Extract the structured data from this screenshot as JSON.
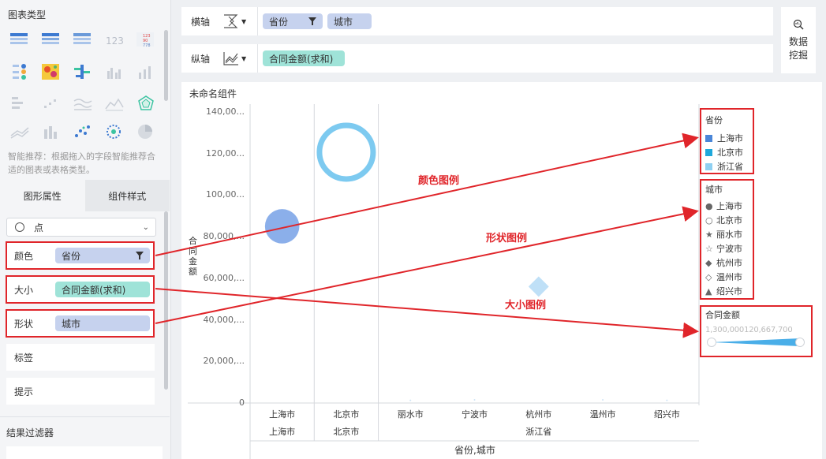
{
  "left": {
    "chart_type_title": "图表类型",
    "smart_tip": "智能推荐：根据拖入的字段智能推荐合适的图表或表格类型。",
    "tabs": [
      {
        "label": "图形属性"
      },
      {
        "label": "组件样式"
      }
    ],
    "mark_type": "点",
    "props": {
      "color": {
        "label": "颜色",
        "field": "省份"
      },
      "size": {
        "label": "大小",
        "field": "合同金额(求和)"
      },
      "shape": {
        "label": "形状",
        "field": "城市"
      },
      "tag": {
        "label": "标签"
      },
      "tip": {
        "label": "提示"
      }
    },
    "filter_title": "结果过滤器"
  },
  "axes": {
    "x_label": "横轴",
    "x_fields": [
      "省份",
      "城市"
    ],
    "y_label": "纵轴",
    "y_fields": [
      "合同金额(求和)"
    ]
  },
  "mining": {
    "line1": "数据",
    "line2": "挖掘"
  },
  "component_title": "未命名组件",
  "chart": {
    "yticks": [
      "140,00...",
      "120,00...",
      "100,00...",
      "80,000,...",
      "60,000,...",
      "40,000,...",
      "20,000,...",
      "0"
    ],
    "ylabel": "合同金额",
    "city_labels": [
      "上海市",
      "北京市",
      "丽水市",
      "宁波市",
      "杭州市",
      "温州市",
      "绍兴市"
    ],
    "province_labels": [
      "上海市",
      "北京市",
      "浙江省"
    ],
    "xlabel": "省份,城市"
  },
  "chart_data": {
    "type": "scatter",
    "xlabel": "省份,城市",
    "ylabel": "合同金额",
    "ylim": [
      0,
      140000000
    ],
    "categories": [
      "上海市/上海市",
      "北京市/北京市",
      "浙江省/丽水市",
      "浙江省/宁波市",
      "浙江省/杭州市",
      "浙江省/温州市",
      "浙江省/绍兴市"
    ],
    "points": [
      {
        "province": "上海市",
        "city": "上海市",
        "value": 85000000,
        "shape": "circle-filled",
        "color": "#8bafea"
      },
      {
        "province": "北京市",
        "city": "北京市",
        "value": 120667700,
        "shape": "circle-hollow",
        "color": "#7dcaf0"
      },
      {
        "province": "浙江省",
        "city": "丽水市",
        "value": 1300000,
        "shape": "star",
        "color": "#cfe3f5"
      },
      {
        "province": "浙江省",
        "city": "宁波市",
        "value": 1500000,
        "shape": "star-hollow",
        "color": "#cfe3f5"
      },
      {
        "province": "浙江省",
        "city": "杭州市",
        "value": 56000000,
        "shape": "diamond",
        "color": "#bfe0f7"
      },
      {
        "province": "浙江省",
        "city": "温州市",
        "value": 1500000,
        "shape": "diamond-hollow",
        "color": "#cfe3f5"
      },
      {
        "province": "浙江省",
        "city": "绍兴市",
        "value": 1300000,
        "shape": "triangle",
        "color": "#cfe3f5"
      }
    ]
  },
  "legends": {
    "color_title": "省份",
    "color_items": [
      {
        "label": "上海市",
        "color": "#4a86d8"
      },
      {
        "label": "北京市",
        "color": "#1ea8db"
      },
      {
        "label": "浙江省",
        "color": "#8fd0f2"
      }
    ],
    "shape_title": "城市",
    "shape_items": [
      {
        "label": "上海市",
        "icon": "●"
      },
      {
        "label": "北京市",
        "icon": "○"
      },
      {
        "label": "丽水市",
        "icon": "★"
      },
      {
        "label": "宁波市",
        "icon": "☆"
      },
      {
        "label": "杭州市",
        "icon": "◆"
      },
      {
        "label": "温州市",
        "icon": "◇"
      },
      {
        "label": "绍兴市",
        "icon": "▲"
      }
    ],
    "size_title": "合同金额",
    "size_range": "1,300,000120,667,700"
  },
  "annotations": {
    "color_legend": "颜色图例",
    "shape_legend": "形状图例",
    "size_legend": "大小图例"
  }
}
